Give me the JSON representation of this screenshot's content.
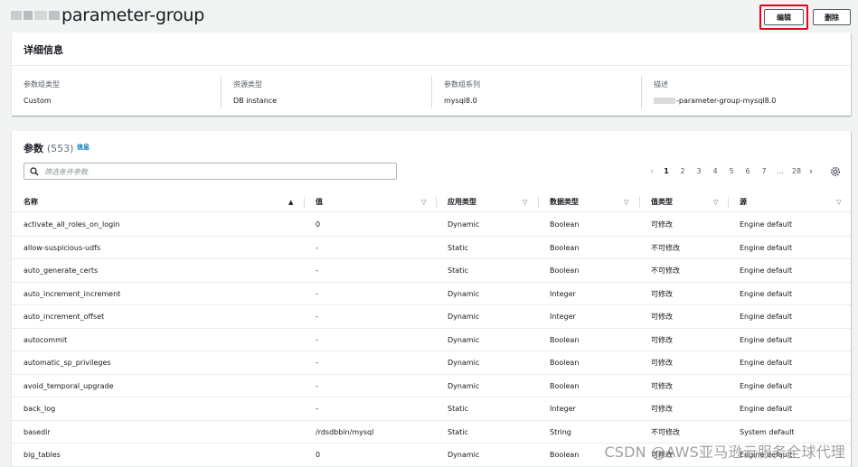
{
  "header": {
    "title": "parameter-group",
    "edit_label": "编辑",
    "delete_label": "删除"
  },
  "details": {
    "title": "详细信息",
    "fields": [
      {
        "key": "参数组类型",
        "value": "Custom"
      },
      {
        "key": "资源类型",
        "value": "DB instance"
      },
      {
        "key": "参数组系列",
        "value": "mysql8.0"
      },
      {
        "key": "描述",
        "value": "-parameter-group-mysql8.0"
      }
    ]
  },
  "params": {
    "title": "参数",
    "count": "(553)",
    "info": "信息",
    "search_placeholder": "筛选条件参数",
    "pagination": {
      "pages": [
        "1",
        "2",
        "3",
        "4",
        "5",
        "6",
        "7",
        "...",
        "28"
      ],
      "current": "1"
    },
    "columns": [
      "名称",
      "值",
      "应用类型",
      "数据类型",
      "值类型",
      "源"
    ],
    "rows": [
      [
        "activate_all_roles_on_login",
        "0",
        "Dynamic",
        "Boolean",
        "可修改",
        "Engine default"
      ],
      [
        "allow-suspicious-udfs",
        "-",
        "Static",
        "Boolean",
        "不可修改",
        "Engine default"
      ],
      [
        "auto_generate_certs",
        "-",
        "Static",
        "Boolean",
        "不可修改",
        "Engine default"
      ],
      [
        "auto_increment_increment",
        "-",
        "Dynamic",
        "Integer",
        "可修改",
        "Engine default"
      ],
      [
        "auto_increment_offset",
        "-",
        "Dynamic",
        "Integer",
        "可修改",
        "Engine default"
      ],
      [
        "autocommit",
        "-",
        "Dynamic",
        "Boolean",
        "可修改",
        "Engine default"
      ],
      [
        "automatic_sp_privileges",
        "-",
        "Dynamic",
        "Boolean",
        "可修改",
        "Engine default"
      ],
      [
        "avoid_temporal_upgrade",
        "-",
        "Dynamic",
        "Boolean",
        "可修改",
        "Engine default"
      ],
      [
        "back_log",
        "-",
        "Static",
        "Integer",
        "可修改",
        "Engine default"
      ],
      [
        "basedir",
        "/rdsdbbin/mysql",
        "Static",
        "String",
        "不可修改",
        "System default"
      ],
      [
        "big_tables",
        "0",
        "Dynamic",
        "Boolean",
        "可修改",
        "Engine default"
      ]
    ]
  },
  "watermark": "CSDN @AWS亚马逊云服务全球代理",
  "colors": {
    "link": "#0073bb",
    "highlight": "#e3061b",
    "border": "#eaeded",
    "text": "#16191f"
  }
}
